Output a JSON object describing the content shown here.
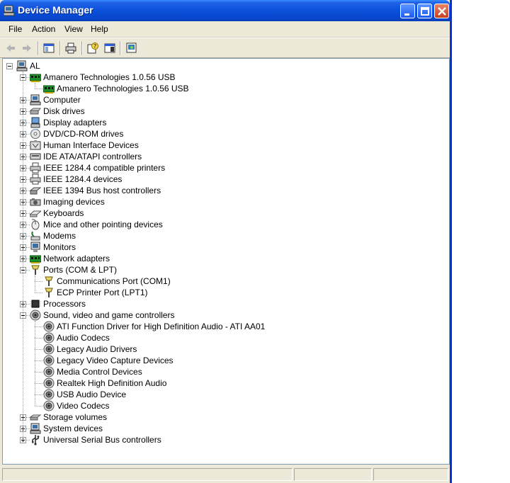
{
  "window": {
    "title": "Device Manager"
  },
  "menu": [
    "File",
    "Action",
    "View",
    "Help"
  ],
  "toolbar": [
    "back-arrow-icon",
    "forward-arrow-icon",
    "show-hide-console-tree-icon",
    "print-icon",
    "help-icon",
    "properties-icon",
    "scan-hardware-icon"
  ],
  "tree": {
    "root": "AL",
    "items": [
      {
        "label": "Amanero Technologies 1.0.56 USB",
        "icon": "board-icon",
        "expanded": true,
        "children": [
          {
            "label": "Amanero Technologies 1.0.56 USB",
            "icon": "board-icon"
          }
        ]
      },
      {
        "label": "Computer",
        "icon": "computer-icon"
      },
      {
        "label": "Disk drives",
        "icon": "disk-drive-icon"
      },
      {
        "label": "Display adapters",
        "icon": "display-adapter-icon"
      },
      {
        "label": "DVD/CD-ROM drives",
        "icon": "cdrom-icon"
      },
      {
        "label": "Human Interface Devices",
        "icon": "hid-icon"
      },
      {
        "label": "IDE ATA/ATAPI controllers",
        "icon": "ide-controller-icon"
      },
      {
        "label": "IEEE 1284.4 compatible printers",
        "icon": "printer-icon"
      },
      {
        "label": "IEEE 1284.4 devices",
        "icon": "printer-icon"
      },
      {
        "label": "IEEE 1394 Bus host controllers",
        "icon": "firewire-icon"
      },
      {
        "label": "Imaging devices",
        "icon": "imaging-icon"
      },
      {
        "label": "Keyboards",
        "icon": "keyboard-icon"
      },
      {
        "label": "Mice and other pointing devices",
        "icon": "mouse-icon"
      },
      {
        "label": "Modems",
        "icon": "modem-icon"
      },
      {
        "label": "Monitors",
        "icon": "monitor-icon"
      },
      {
        "label": "Network adapters",
        "icon": "board-icon"
      },
      {
        "label": "Ports (COM & LPT)",
        "icon": "port-icon",
        "expanded": true,
        "children": [
          {
            "label": "Communications Port (COM1)",
            "icon": "port-icon"
          },
          {
            "label": "ECP Printer Port (LPT1)",
            "icon": "port-icon"
          }
        ]
      },
      {
        "label": "Processors",
        "icon": "processor-icon"
      },
      {
        "label": "Sound, video and game controllers",
        "icon": "sound-icon",
        "expanded": true,
        "children": [
          {
            "label": "ATI Function Driver for High Definition Audio - ATI AA01",
            "icon": "sound-icon"
          },
          {
            "label": "Audio Codecs",
            "icon": "sound-icon"
          },
          {
            "label": "Legacy Audio Drivers",
            "icon": "sound-icon"
          },
          {
            "label": "Legacy Video Capture Devices",
            "icon": "sound-icon"
          },
          {
            "label": "Media Control Devices",
            "icon": "sound-icon"
          },
          {
            "label": "Realtek High Definition Audio",
            "icon": "sound-icon"
          },
          {
            "label": "USB Audio Device",
            "icon": "sound-icon"
          },
          {
            "label": "Video Codecs",
            "icon": "sound-icon"
          }
        ]
      },
      {
        "label": "Storage volumes",
        "icon": "storage-icon"
      },
      {
        "label": "System devices",
        "icon": "computer-icon"
      },
      {
        "label": "Universal Serial Bus controllers",
        "icon": "usb-icon"
      }
    ]
  }
}
